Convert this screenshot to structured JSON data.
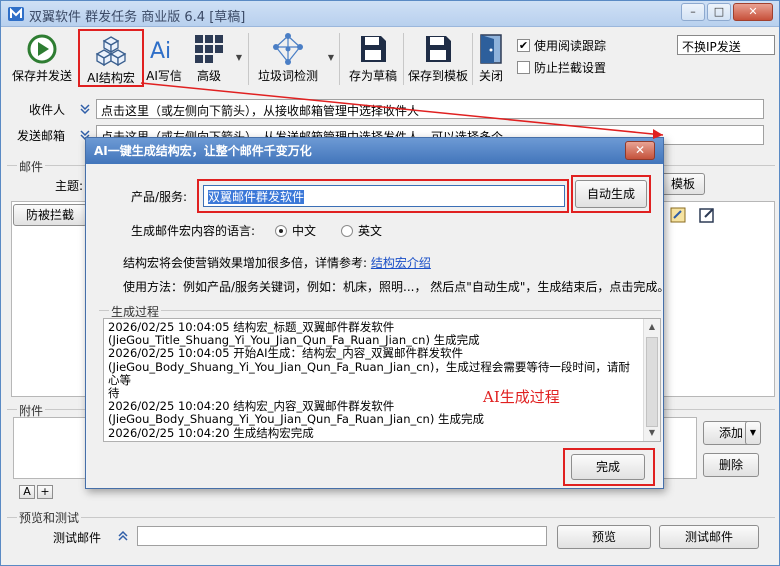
{
  "window": {
    "title": "双翼软件 群发任务 商业版 6.4 [草稿]",
    "controls": {
      "minimize": "–",
      "maximize": "□",
      "close": "✕"
    }
  },
  "toolbar": {
    "save_send": "保存并发送",
    "ai_macro": "AI结构宏",
    "ai_write": "AI写信",
    "advanced": "高级",
    "spam_check": "垃圾词检测",
    "save_draft": "存为草稿",
    "save_template": "保存到模板",
    "close": "关闭"
  },
  "options": {
    "read_tracking": "使用阅读跟踪",
    "anti_block": "防止拦截设置",
    "ip_mode": "不换IP发送"
  },
  "recipient": {
    "label": "收件人",
    "placeholder": "点击这里（或左侧向下箭头），从接收邮箱管理中选择收件人"
  },
  "sender": {
    "label": "发送邮箱",
    "placeholder": "点击这里（或左侧向下箭头），从发送邮箱管理中选择发件人，可以选择多个"
  },
  "mail_section": {
    "title": "邮件",
    "subject_label": "主题:",
    "template_button": "模板",
    "anti_block_button": "防被拦截"
  },
  "attachments": {
    "title": "附件",
    "add_button": "添加",
    "delete_button": "删除",
    "tab_a": "A",
    "tab_plus": "+"
  },
  "preview": {
    "title": "预览和测试",
    "test_mail_label": "测试邮件",
    "preview_button": "预览",
    "test_button": "测试邮件"
  },
  "dialog": {
    "title": "AI一键生成结构宏，让整个邮件千变万化",
    "close": "✕",
    "product_label": "产品/服务:",
    "product_value": "双翼邮件群发软件",
    "auto_generate": "自动生成",
    "lang_label": "生成邮件宏内容的语言:",
    "lang_zh": "中文",
    "lang_en": "英文",
    "info_text": "结构宏将会使营销效果增加很多倍，详情参考:",
    "info_link": "结构宏介绍",
    "usage_text": "使用方法：例如产品/服务关键词，例如：机床，照明...， 然后点\"自动生成\"，生成结束后，点击完成。",
    "progress_title": "生成过程",
    "log_lines": [
      "2026/02/25 10:04:05 结构宏_标题_双翼邮件群发软件",
      "(JieGou_Title_Shuang_Yi_You_Jian_Qun_Fa_Ruan_Jian_cn) 生成完成",
      "2026/02/25 10:04:05 开始AI生成：结构宏_内容_双翼邮件群发软件",
      "(JieGou_Body_Shuang_Yi_You_Jian_Qun_Fa_Ruan_Jian_cn)，生成过程会需要等待一段时间，请耐心等",
      "待",
      "2026/02/25 10:04:20 结构宏_内容_双翼邮件群发软件",
      "(JieGou_Body_Shuang_Yi_You_Jian_Qun_Fa_Ruan_Jian_cn) 生成完成",
      "2026/02/25 10:04:20 生成结构宏完成"
    ],
    "annotation": "AI生成过程",
    "finish_button": "完成"
  },
  "colors": {
    "highlight_red": "#e02020",
    "dialog_title_blue": "#4275bb",
    "link_blue": "#1a4fc7"
  }
}
